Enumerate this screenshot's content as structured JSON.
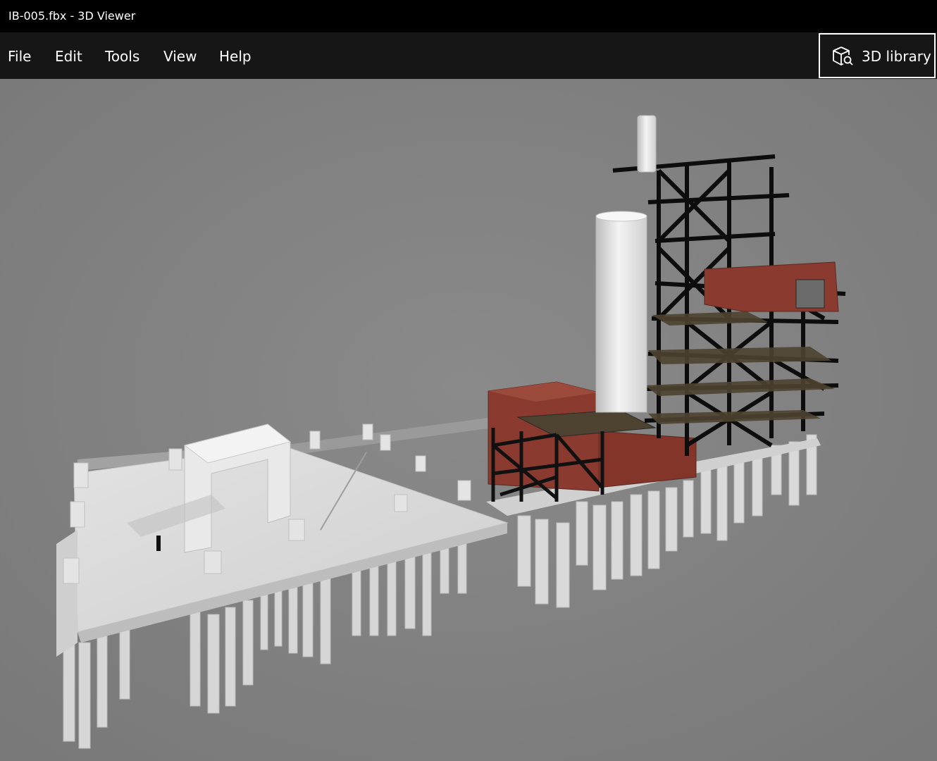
{
  "window": {
    "title": "IB-005.fbx - 3D Viewer"
  },
  "menu": {
    "items": [
      "File",
      "Edit",
      "Tools",
      "View",
      "Help"
    ],
    "library_button": {
      "label": "3D library",
      "icon": "cube-search-icon"
    }
  },
  "viewport": {
    "background_color": "#808080",
    "model_colors": {
      "concrete": "#d9d9d9",
      "steel": "#111111",
      "cladding": "#8a3a2e",
      "floor_grating": "#4d4330",
      "stack": "#ececec"
    }
  }
}
